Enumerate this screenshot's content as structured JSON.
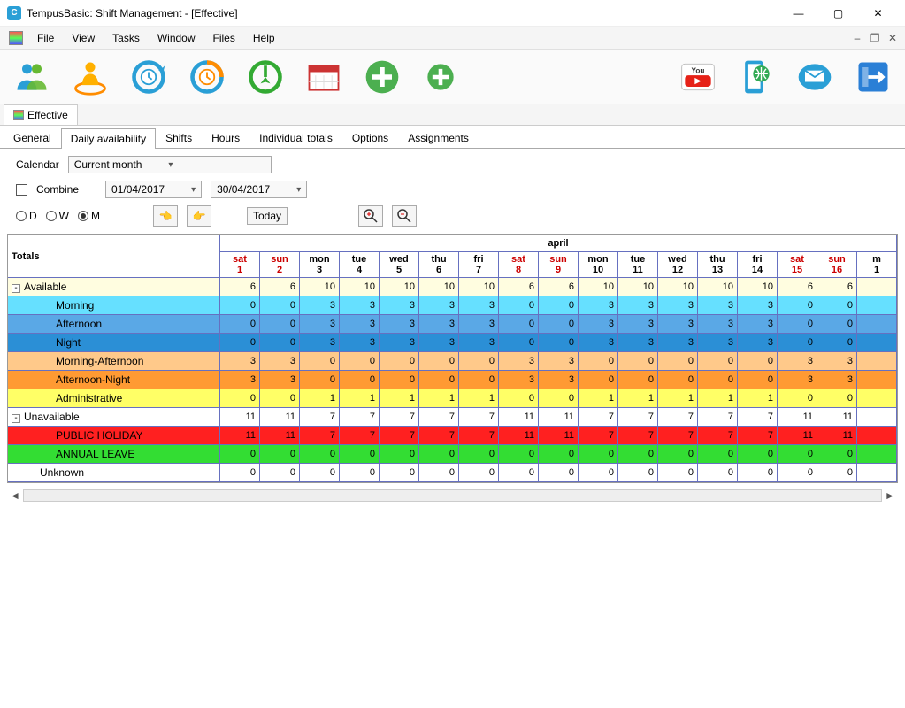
{
  "window": {
    "title": "TempusBasic: Shift Management - [Effective]"
  },
  "menu": [
    "File",
    "View",
    "Tasks",
    "Window",
    "Files",
    "Help"
  ],
  "subtab": "Effective",
  "tabs": [
    "General",
    "Daily availability",
    "Shifts",
    "Hours",
    "Individual totals",
    "Options",
    "Assignments"
  ],
  "activeTab": 1,
  "controls": {
    "calendarLabel": "Calendar",
    "calendarValue": "Current month",
    "combineLabel": "Combine",
    "dateFrom": "01/04/2017",
    "dateTo": "30/04/2017",
    "radD": "D",
    "radW": "W",
    "radM": "M",
    "todayBtn": "Today"
  },
  "grid": {
    "totalsHeader": "Totals",
    "month": "april",
    "cols": [
      {
        "dow": "sat",
        "day": "1",
        "we": true
      },
      {
        "dow": "sun",
        "day": "2",
        "we": true
      },
      {
        "dow": "mon",
        "day": "3",
        "we": false
      },
      {
        "dow": "tue",
        "day": "4",
        "we": false
      },
      {
        "dow": "wed",
        "day": "5",
        "we": false
      },
      {
        "dow": "thu",
        "day": "6",
        "we": false
      },
      {
        "dow": "fri",
        "day": "7",
        "we": false
      },
      {
        "dow": "sat",
        "day": "8",
        "we": true
      },
      {
        "dow": "sun",
        "day": "9",
        "we": true
      },
      {
        "dow": "mon",
        "day": "10",
        "we": false
      },
      {
        "dow": "tue",
        "day": "11",
        "we": false
      },
      {
        "dow": "wed",
        "day": "12",
        "we": false
      },
      {
        "dow": "thu",
        "day": "13",
        "we": false
      },
      {
        "dow": "fri",
        "day": "14",
        "we": false
      },
      {
        "dow": "sat",
        "day": "15",
        "we": true
      },
      {
        "dow": "sun",
        "day": "16",
        "we": true
      },
      {
        "dow": "m",
        "day": "1",
        "we": false
      }
    ],
    "rows": [
      {
        "label": "Available",
        "cls": "bg-available",
        "indent": 0,
        "tree": "-",
        "vals": [
          6,
          6,
          10,
          10,
          10,
          10,
          10,
          6,
          6,
          10,
          10,
          10,
          10,
          10,
          6,
          6,
          ""
        ]
      },
      {
        "label": "Morning",
        "cls": "bg-morning",
        "indent": 2,
        "vals": [
          0,
          0,
          3,
          3,
          3,
          3,
          3,
          0,
          0,
          3,
          3,
          3,
          3,
          3,
          0,
          0,
          ""
        ]
      },
      {
        "label": "Afternoon",
        "cls": "bg-afternoon",
        "indent": 2,
        "vals": [
          0,
          0,
          3,
          3,
          3,
          3,
          3,
          0,
          0,
          3,
          3,
          3,
          3,
          3,
          0,
          0,
          ""
        ]
      },
      {
        "label": "Night",
        "cls": "bg-night",
        "indent": 2,
        "vals": [
          0,
          0,
          3,
          3,
          3,
          3,
          3,
          0,
          0,
          3,
          3,
          3,
          3,
          3,
          0,
          0,
          ""
        ]
      },
      {
        "label": "Morning-Afternoon",
        "cls": "bg-mornaft",
        "indent": 2,
        "vals": [
          3,
          3,
          0,
          0,
          0,
          0,
          0,
          3,
          3,
          0,
          0,
          0,
          0,
          0,
          3,
          3,
          ""
        ]
      },
      {
        "label": "Afternoon-Night",
        "cls": "bg-aftnight",
        "indent": 2,
        "vals": [
          3,
          3,
          0,
          0,
          0,
          0,
          0,
          3,
          3,
          0,
          0,
          0,
          0,
          0,
          3,
          3,
          ""
        ]
      },
      {
        "label": "Administrative",
        "cls": "bg-admin",
        "indent": 2,
        "vals": [
          0,
          0,
          1,
          1,
          1,
          1,
          1,
          0,
          0,
          1,
          1,
          1,
          1,
          1,
          0,
          0,
          ""
        ]
      },
      {
        "label": "Unavailable",
        "cls": "bg-unavail",
        "indent": 0,
        "tree": "-",
        "vals": [
          11,
          11,
          7,
          7,
          7,
          7,
          7,
          11,
          11,
          7,
          7,
          7,
          7,
          7,
          11,
          11,
          ""
        ]
      },
      {
        "label": "PUBLIC HOLIDAY",
        "cls": "bg-holiday",
        "indent": 2,
        "vals": [
          11,
          11,
          7,
          7,
          7,
          7,
          7,
          11,
          11,
          7,
          7,
          7,
          7,
          7,
          11,
          11,
          ""
        ]
      },
      {
        "label": "ANNUAL LEAVE",
        "cls": "bg-annual",
        "indent": 2,
        "vals": [
          0,
          0,
          0,
          0,
          0,
          0,
          0,
          0,
          0,
          0,
          0,
          0,
          0,
          0,
          0,
          0,
          ""
        ]
      },
      {
        "label": "Unknown",
        "cls": "bg-unknown",
        "indent": 1,
        "vals": [
          0,
          0,
          0,
          0,
          0,
          0,
          0,
          0,
          0,
          0,
          0,
          0,
          0,
          0,
          0,
          0,
          ""
        ]
      }
    ]
  }
}
